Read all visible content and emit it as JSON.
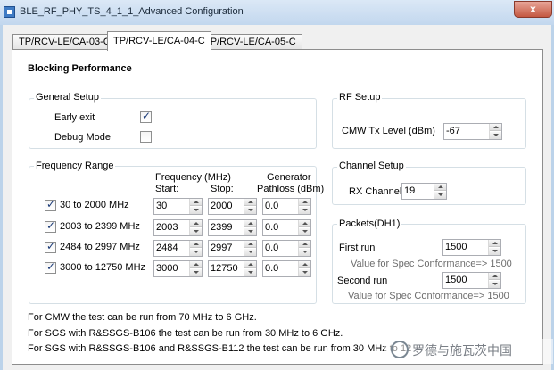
{
  "window": {
    "title": "BLE_RF_PHY_TS_4_1_1_Advanced Configuration",
    "close_glyph": "x"
  },
  "tabs": [
    {
      "label": "TP/RCV-LE/CA-03-C",
      "active": false
    },
    {
      "label": "TP/RCV-LE/CA-04-C",
      "active": true
    },
    {
      "label": "TP/RCV-LE/CA-05-C",
      "active": false
    }
  ],
  "panel": {
    "heading": "Blocking Performance"
  },
  "general_setup": {
    "legend": "General Setup",
    "early_exit": {
      "label": "Early exit",
      "checked": true
    },
    "debug_mode": {
      "label": "Debug Mode",
      "checked": false
    }
  },
  "frequency_range": {
    "legend": "Frequency Range",
    "col_frequency": "Frequency (MHz)",
    "col_start": "Start:",
    "col_stop": "Stop:",
    "col_generator": "Generator",
    "col_pathloss": "Pathloss (dBm)",
    "rows": [
      {
        "label": "30 to 2000 MHz",
        "checked": true,
        "start": "30",
        "stop": "2000",
        "pathloss": "0.0"
      },
      {
        "label": "2003 to 2399 MHz",
        "checked": true,
        "start": "2003",
        "stop": "2399",
        "pathloss": "0.0"
      },
      {
        "label": "2484 to 2997 MHz",
        "checked": true,
        "start": "2484",
        "stop": "2997",
        "pathloss": "0.0"
      },
      {
        "label": "3000 to 12750 MHz",
        "checked": true,
        "start": "3000",
        "stop": "12750",
        "pathloss": "0.0"
      }
    ]
  },
  "rf_setup": {
    "legend": "RF Setup",
    "cmw_tx_label": "CMW Tx Level (dBm)",
    "cmw_tx_value": "-67"
  },
  "channel_setup": {
    "legend": "Channel Setup",
    "rx_channel_label": "RX Channel",
    "rx_channel_value": "19"
  },
  "packets": {
    "legend": "Packets(DH1)",
    "first_run_label": "First run",
    "first_run_value": "1500",
    "first_run_hint": "Value for Spec Conformance=> 1500",
    "second_run_label": "Second run",
    "second_run_value": "1500",
    "second_run_hint": "Value for Spec Conformance=> 1500"
  },
  "notes": [
    "For CMW the test can be run from 70 MHz to 6 GHz.",
    "For SGS with R&SSGS-B106 the test can be run from 30 MHz to 6 GHz.",
    "For SGS with R&SSGS-B106 and R&SSGS-B112 the test can be run from 30 MHz to 12"
  ],
  "watermark": {
    "text": "罗德与施瓦茨中国"
  },
  "colors": {
    "titlebar": "#c2d7ee",
    "groupbox_border": "#d5dfe5",
    "close_button": "#c45841"
  }
}
